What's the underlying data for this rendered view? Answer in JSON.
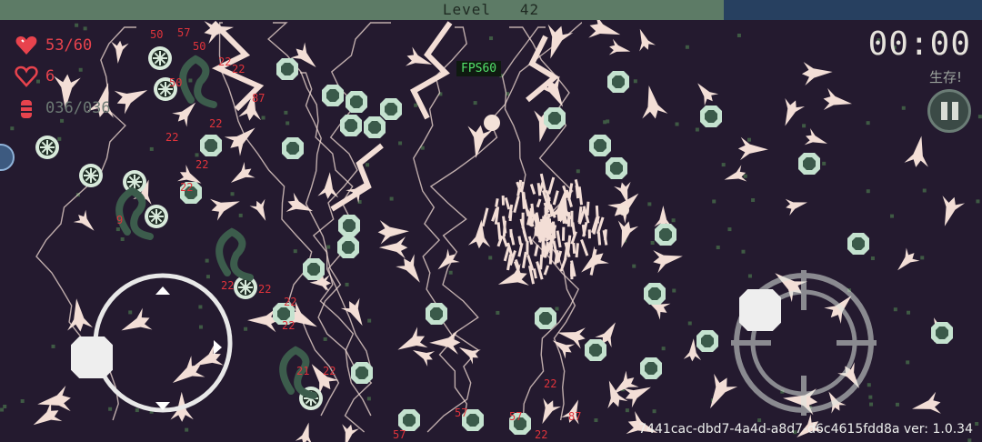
{
  "level": {
    "label": "Level",
    "value": "42",
    "progress_fraction": 0.737
  },
  "hp": {
    "text": "53/60",
    "icon": "heart-icon",
    "color": "#e8434d"
  },
  "shield": {
    "text": "6",
    "icon": "shield-heart-icon",
    "color": "#e8434d"
  },
  "ammo": {
    "text": "036/036",
    "icon": "ammo-icon",
    "color": "#e8434d",
    "text_color": "#6d7a74"
  },
  "fps": "FPS60",
  "timer": "00:00",
  "objective": "生存!",
  "pause": {
    "icon": "pause-icon"
  },
  "joystick": {
    "icons": [
      "arrow-up-icon",
      "arrow-right-icon",
      "arrow-down-icon"
    ]
  },
  "aim": {
    "icon": "crosshair-icon"
  },
  "version_text": "7441cac-dbd7-4a4d-a8d7-d6c4615fdd8a ver: 1.0.34",
  "damage_numbers": [
    "50",
    "57",
    "50",
    "22",
    "87",
    "50",
    "22",
    "22",
    "22",
    "22",
    "9",
    "22",
    "22",
    "22",
    "22",
    "21",
    "22",
    "22",
    "57",
    "22",
    "57",
    "22",
    "57",
    "87"
  ],
  "colors": {
    "background": "#241a2f",
    "level_bar_fill": "#5d7b66",
    "level_bar_empty": "#274060",
    "lightning": "#f3ded6",
    "enemy": "#c4e2cf",
    "enemy_dark": "#3a5a4a",
    "damage": "#e0333b"
  }
}
